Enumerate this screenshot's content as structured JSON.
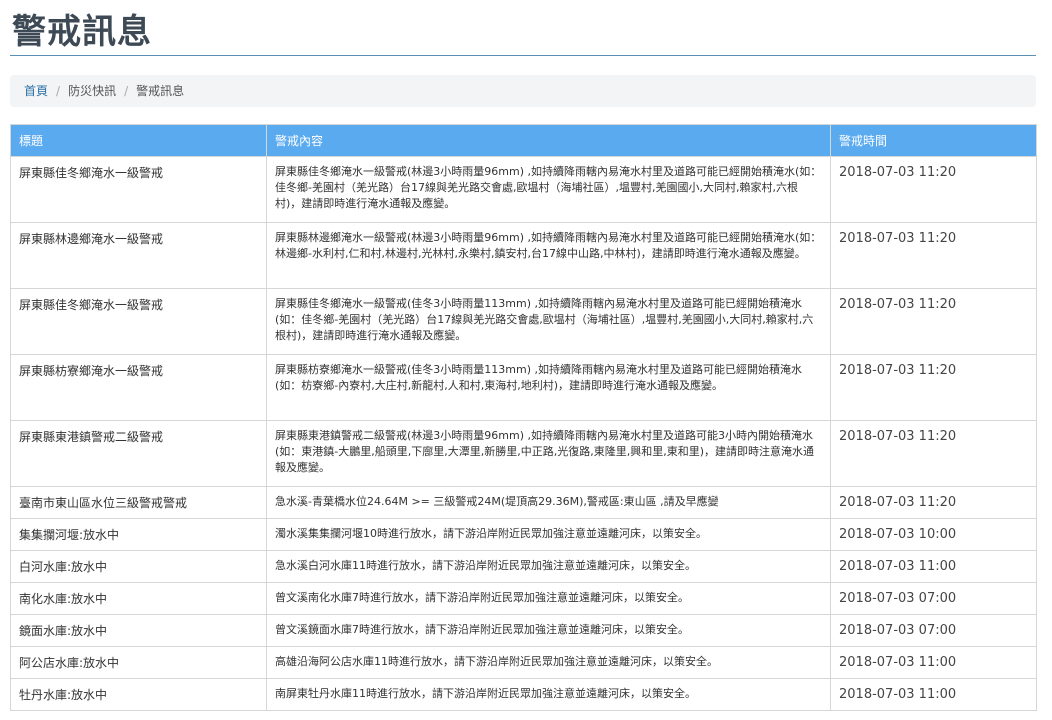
{
  "page": {
    "title": "警戒訊息"
  },
  "breadcrumb": {
    "items": [
      "首頁",
      "防災快訊",
      "警戒訊息"
    ],
    "separator": "/"
  },
  "table": {
    "headers": [
      "標題",
      "警戒內容",
      "警戒時間"
    ],
    "rows": [
      {
        "title": "屏東縣佳冬鄉淹水一級警戒",
        "content": "屏東縣佳冬鄉淹水一級警戒(林邊3小時雨量96mm) ,如持續降雨轄內易淹水村里及道路可能已經開始積淹水(如：佳冬鄉-羌園村（羌光路）台17線與羌光路交會處,歐塭村（海埔社區）,塭豐村,羌園國小,大同村,賴家村,六根村)，建請即時進行淹水通報及應變。",
        "time": "2018-07-03 11:20"
      },
      {
        "title": "屏東縣林邊鄉淹水一級警戒",
        "content": "屏東縣林邊鄉淹水一級警戒(林邊3小時雨量96mm) ,如持續降雨轄內易淹水村里及道路可能已經開始積淹水(如：林邊鄉-水利村,仁和村,林邊村,光林村,永樂村,鎮安村,台17線中山路,中林村)，建請即時進行淹水通報及應變。",
        "time": "2018-07-03 11:20"
      },
      {
        "title": "屏東縣佳冬鄉淹水一級警戒",
        "content": "屏東縣佳冬鄉淹水一級警戒(佳冬3小時雨量113mm) ,如持續降雨轄內易淹水村里及道路可能已經開始積淹水(如：佳冬鄉-羌園村（羌光路）台17線與羌光路交會處,歐塭村（海埔社區）,塭豐村,羌園國小,大同村,賴家村,六根村)，建請即時進行淹水通報及應變。",
        "time": "2018-07-03 11:20"
      },
      {
        "title": "屏東縣枋寮鄉淹水一級警戒",
        "content": "屏東縣枋寮鄉淹水一級警戒(佳冬3小時雨量113mm) ,如持續降雨轄內易淹水村里及道路可能已經開始積淹水(如：枋寮鄉-內寮村,大庄村,新龍村,人和村,東海村,地利村)，建請即時進行淹水通報及應變。",
        "time": "2018-07-03 11:20"
      },
      {
        "title": "屏東縣東港鎮警戒二級警戒",
        "content": "屏東縣東港鎮警戒二級警戒(林邊3小時雨量96mm) ,如持續降雨轄內易淹水村里及道路可能3小時內開始積淹水(如：東港鎮-大鵬里,船頭里,下廍里,大潭里,新勝里,中正路,光復路,東隆里,興和里,東和里)，建請即時注意淹水通報及應變。",
        "time": "2018-07-03 11:20"
      },
      {
        "title": "臺南市東山區水位三級警戒警戒",
        "content": "急水溪-青葉橋水位24.64M >= 三級警戒24M(堤頂高29.36M),警戒區:東山區 ,請及早應變",
        "time": "2018-07-03 11:20"
      },
      {
        "title": "集集攔河堰:放水中",
        "content": "濁水溪集集攔河堰10時進行放水，請下游沿岸附近民眾加強注意並遠離河床，以策安全。",
        "time": "2018-07-03 10:00"
      },
      {
        "title": "白河水庫:放水中",
        "content": "急水溪白河水庫11時進行放水，請下游沿岸附近民眾加強注意並遠離河床，以策安全。",
        "time": "2018-07-03 11:00"
      },
      {
        "title": "南化水庫:放水中",
        "content": "曾文溪南化水庫7時進行放水，請下游沿岸附近民眾加強注意並遠離河床，以策安全。",
        "time": "2018-07-03 07:00"
      },
      {
        "title": "鏡面水庫:放水中",
        "content": "曾文溪鏡面水庫7時進行放水，請下游沿岸附近民眾加強注意並遠離河床，以策安全。",
        "time": "2018-07-03 07:00"
      },
      {
        "title": "阿公店水庫:放水中",
        "content": "高雄沿海阿公店水庫11時進行放水，請下游沿岸附近民眾加強注意並遠離河床，以策安全。",
        "time": "2018-07-03 11:00"
      },
      {
        "title": "牡丹水庫:放水中",
        "content": "南屏東牡丹水庫11時進行放水，請下游沿岸附近民眾加強注意並遠離河床，以策安全。",
        "time": "2018-07-03 11:00"
      }
    ]
  }
}
